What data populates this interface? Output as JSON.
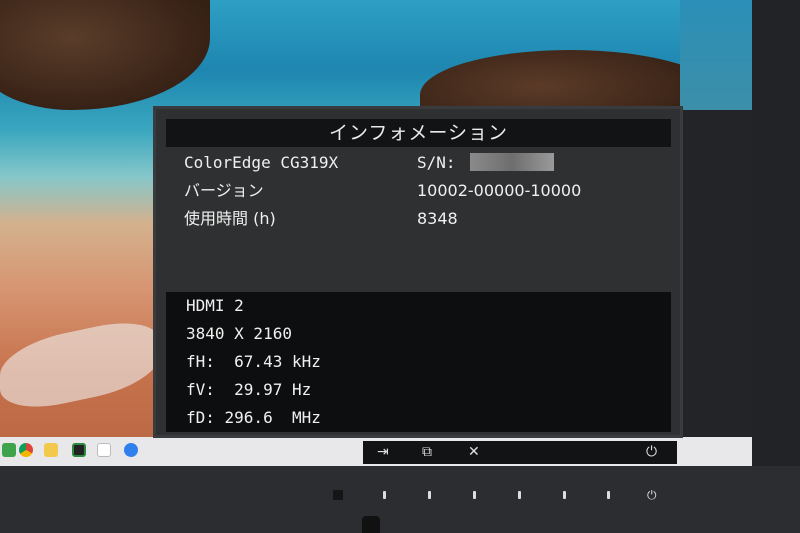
{
  "osd": {
    "title": "インフォメーション",
    "model": "ColorEdge CG319X",
    "sn_label": "S/N:",
    "version_label": "バージョン",
    "version_value": "10002-00000-10000",
    "usage_label": "使用時間 (h)",
    "usage_value": "8348",
    "signal": {
      "input": "HDMI 2",
      "resolution": "3840 X 2160",
      "fh": "fH:  67.43 kHz",
      "fv": "fV:  29.97 Hz",
      "fd": "fD: 296.6  MHz"
    }
  },
  "button_guide": {
    "icons": [
      "input-icon",
      "mode-icon",
      "close-icon",
      "power-icon"
    ],
    "glyphs": [
      "⇥",
      "⧉",
      "✕",
      "⏻"
    ]
  },
  "colors": {
    "osd_bg": "#2f3032",
    "osd_header_bg": "#121314",
    "signal_panel_bg": "#0d0e0f",
    "text": "#f0f0f0"
  }
}
